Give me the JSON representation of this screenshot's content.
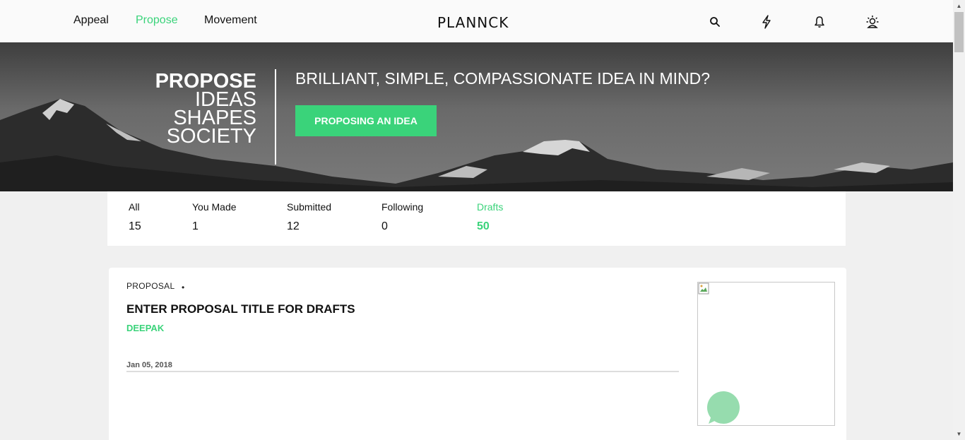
{
  "nav": {
    "links": [
      "Appeal",
      "Propose",
      "Movement"
    ],
    "active_link": "Propose",
    "logo": "PLANNCK",
    "icons": [
      "search-icon",
      "lightning-icon",
      "bell-icon",
      "user-sun-icon"
    ]
  },
  "hero": {
    "heading_bold": "PROPOSE",
    "heading_lines": [
      "IDEAS",
      "SHAPES",
      "SOCIETY"
    ],
    "question": "BRILLIANT, SIMPLE, COMPASSIONATE IDEA IN MIND?",
    "button_label": "PROPOSING AN IDEA"
  },
  "stats": [
    {
      "label": "All",
      "value": "15"
    },
    {
      "label": "You Made",
      "value": "1"
    },
    {
      "label": "Submitted",
      "value": "12"
    },
    {
      "label": "Following",
      "value": "0"
    },
    {
      "label": "Drafts",
      "value": "50"
    }
  ],
  "active_stat": "Drafts",
  "card": {
    "type": "PROPOSAL",
    "separator": "•",
    "title": "ENTER PROPOSAL TITLE FOR DRAFTS",
    "author": "DEEPAK",
    "date": "Jan 05, 2018"
  },
  "colors": {
    "accent": "#3ad37a",
    "chat_bubble": "#96dcae",
    "background": "#f0f0f0"
  }
}
